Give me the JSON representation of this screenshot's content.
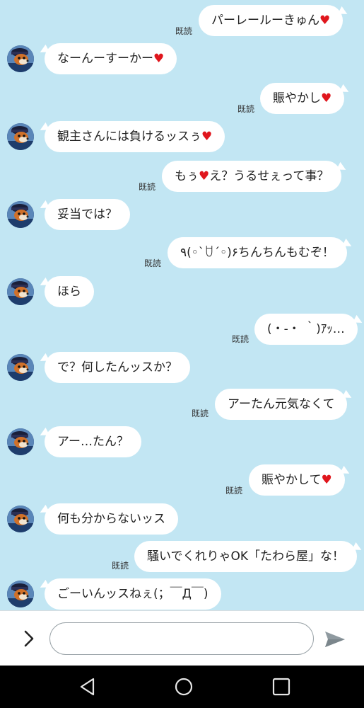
{
  "read_label": "既読",
  "messages": [
    {
      "side": "out",
      "text": "パーレールーきゅん",
      "heart": "♥"
    },
    {
      "side": "in",
      "text": "なーんーすーかー",
      "heart": "♥"
    },
    {
      "side": "out",
      "text": "賑やかし",
      "heart": "♥"
    },
    {
      "side": "in",
      "text": "観主さんには負けるッスぅ",
      "heart": "♥"
    },
    {
      "side": "out",
      "text": "もぅ",
      "heart": "♥",
      "after": "え？うるせぇって事？"
    },
    {
      "side": "in",
      "text": "妥当では？"
    },
    {
      "side": "out",
      "text": "٩(◦`ꇴ´◦)۶ちんちんもむぞ！"
    },
    {
      "side": "in",
      "text": "ほら"
    },
    {
      "side": "out",
      "text": "(・-・ ｀)ｱｯ…"
    },
    {
      "side": "in",
      "text": "で？何したんッスか？"
    },
    {
      "side": "out",
      "text": "アーたん元気なくて"
    },
    {
      "side": "in",
      "text": "アー…たん？"
    },
    {
      "side": "out",
      "text": "賑やかして",
      "heart": "♥"
    },
    {
      "side": "in",
      "text": "何も分からないッス"
    },
    {
      "side": "out",
      "text": "騒いでくれりゃOK「たわら屋」な！"
    },
    {
      "side": "in",
      "text": "ごーいんッスねぇ(；￣Д￣)"
    }
  ],
  "input": {
    "placeholder": "",
    "value": ""
  },
  "colors": {
    "background": "#c2e6f3",
    "heart": "#e0161d",
    "send_arrow": "#8f9aa0"
  },
  "icons": {
    "expand": "chevron-right-icon",
    "send": "send-icon",
    "nav": [
      "back-triangle-icon",
      "home-circle-icon",
      "recents-square-icon"
    ]
  }
}
